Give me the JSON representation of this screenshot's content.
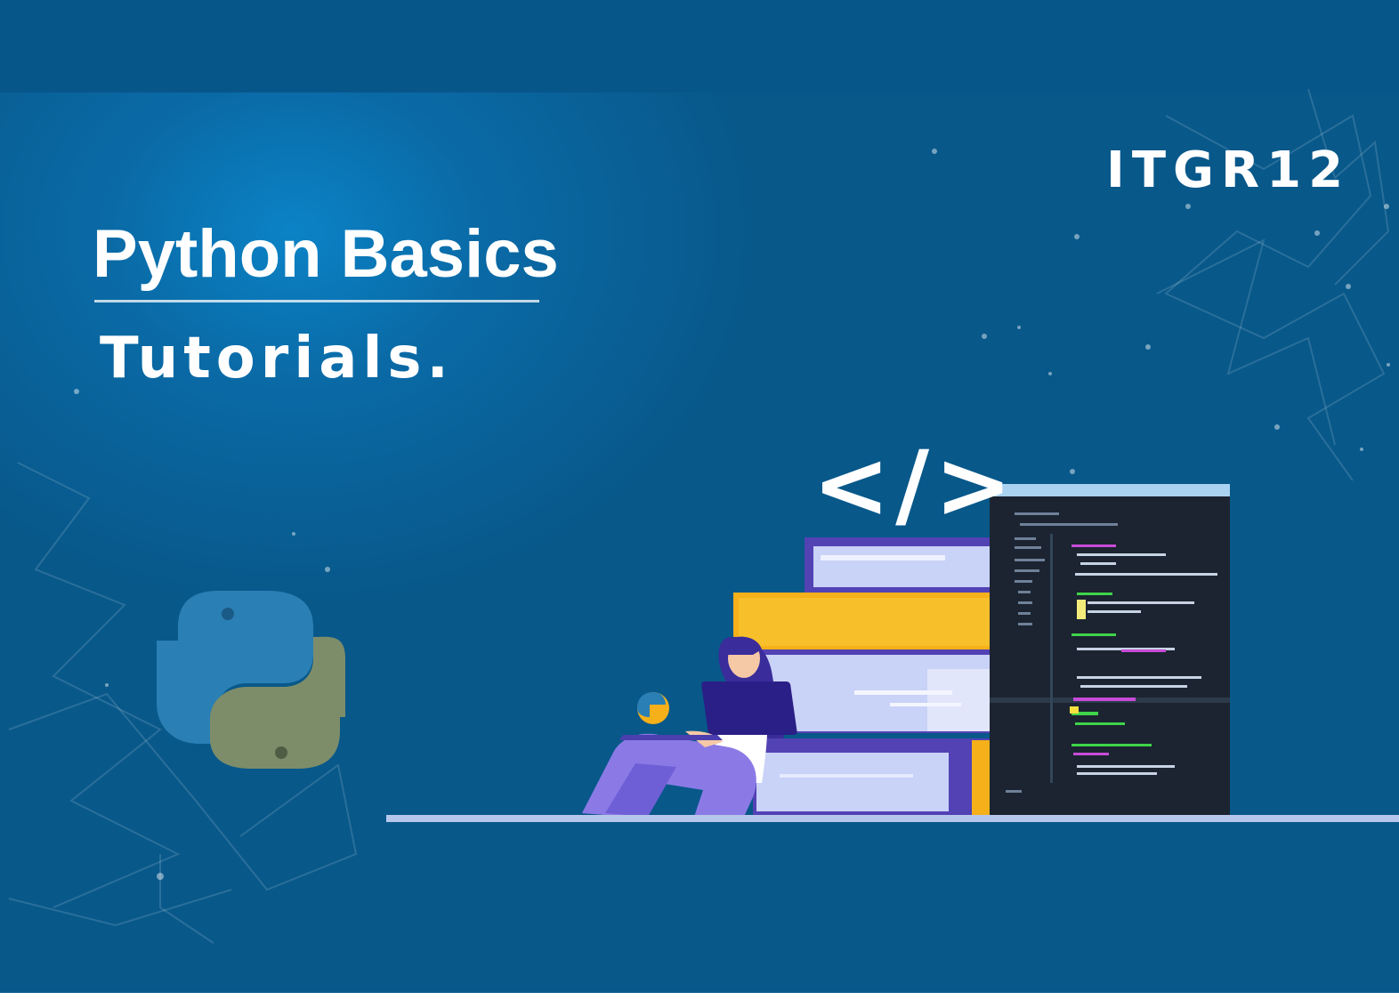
{
  "brand": {
    "text": "ITGR12"
  },
  "heading": {
    "title": "Python Basics",
    "subtitle": "Tutorials."
  },
  "illustration": {
    "code_symbol": "</>"
  },
  "colors": {
    "background": "#08588a",
    "glow": "#0b83c6",
    "python_blue": "#2a7fb4",
    "python_olive": "#7d8d6a",
    "book_lavender": "#c9d2f7",
    "book_yellow": "#f5b01a",
    "book_purple": "#5242b4",
    "editor_dark": "#1b2430",
    "editor_header": "#a9d3f0"
  }
}
